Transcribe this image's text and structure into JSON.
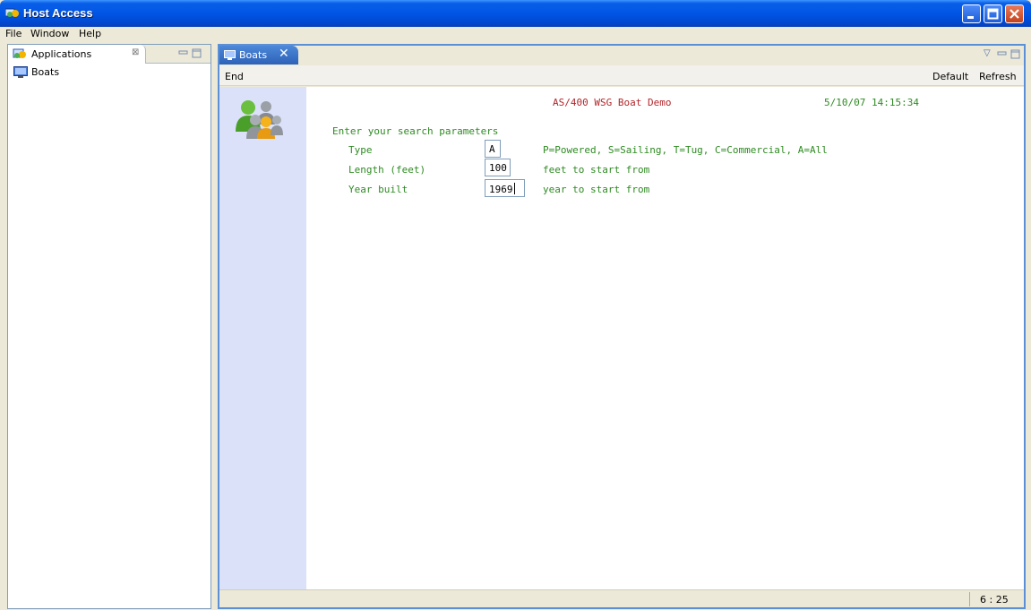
{
  "window": {
    "title": "Host Access",
    "controls": {
      "minimize": "minimize-icon",
      "maximize": "maximize-icon",
      "close": "close-icon"
    }
  },
  "menu": [
    "File",
    "Window",
    "Help"
  ],
  "left_view": {
    "tab_label": "Applications",
    "tab_close": "⊠",
    "tree_items": [
      "Boats"
    ]
  },
  "editor": {
    "tab_label": "Boats",
    "tab_close": "✕",
    "actions_left": [
      "End"
    ],
    "actions_right": [
      "Default",
      "Refresh"
    ]
  },
  "host_screen": {
    "heading": "AS/400 WSG Boat Demo",
    "timestamp": "5/10/07 14:15:34",
    "prompt": "Enter your search parameters",
    "fields": [
      {
        "label": "Type",
        "value": "A",
        "hint": "P=Powered, S=Sailing, T=Tug, C=Commercial, A=All"
      },
      {
        "label": "Length (feet)",
        "value": "100",
        "hint": "feet to start from"
      },
      {
        "label": "Year built",
        "value": "1969",
        "hint": "year to start from"
      }
    ]
  },
  "status": {
    "cursor_position": "6 : 25"
  },
  "colors": {
    "field_label_green": "#2e8b22",
    "heading_red": "#b3262b",
    "side_strip": "#dbe1f9",
    "editor_border": "#5b8fd6"
  }
}
